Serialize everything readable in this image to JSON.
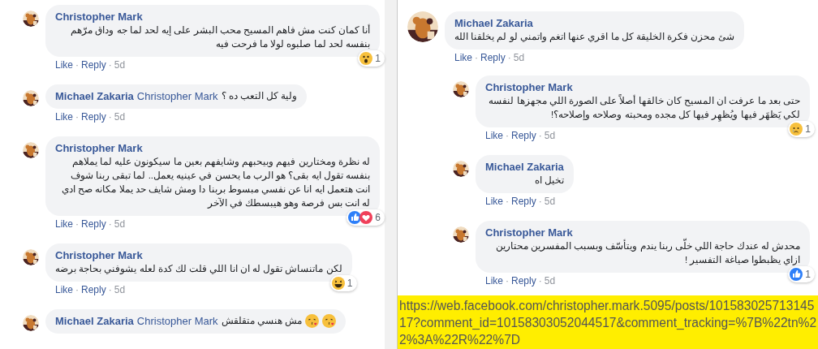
{
  "separator": "·",
  "left_comments": [
    {
      "author": "Christopher Mark",
      "text": "أنا كمان كنت مش فاهم المسيح محب البشر على إيه لحد لما جه وداق مرّهم بنفسه لحد لما صلبوه لولا ما فرحت فيه",
      "reactions": {
        "icons": [
          {
            "kind": "wow"
          }
        ],
        "count": "1"
      },
      "actions": {
        "like": "Like",
        "reply": "Reply",
        "time": "5d"
      }
    },
    {
      "author": "Michael Zakaria",
      "mention": "Christopher Mark",
      "text": "ولية كل التعب ده ؟",
      "actions": {
        "like": "Like",
        "reply": "Reply",
        "time": "5d"
      }
    },
    {
      "author": "Christopher Mark",
      "text": "له نظرة ومختارين فيهم وبيحبهم وشايفهم بعين ما سيكونون عليه لما يملاهم بنفسه تقول ايه بقى؟ هو الرب ما يحسن في عينيه يعمل.. لما تبقى ربنا شوف انت هتعمل ايه انا عن نفسي مبسوط بربنا دا ومش شايف حد يملا مكانه صح ادي له انت بس فرصة وهو هيبسطك في الآخر",
      "reactions": {
        "icons": [
          {
            "kind": "like"
          },
          {
            "kind": "love"
          }
        ],
        "count": "6"
      },
      "actions": {
        "like": "Like",
        "reply": "Reply",
        "time": "5d"
      }
    },
    {
      "author": "Christopher Mark",
      "text": "لكن ماتنساش تقول له ان انا اللي قلت لك كدة لعله يشوفني بحاجة برضه",
      "reactions": {
        "icons": [
          {
            "kind": "haha"
          }
        ],
        "count": "1"
      },
      "actions": {
        "like": "Like",
        "reply": "Reply",
        "time": "5d"
      }
    },
    {
      "author": "Michael Zakaria",
      "mention": "Christopher Mark",
      "text": "مش هنسي متقلقش",
      "emojis": [
        {
          "kind": "kiss"
        },
        {
          "kind": "kiss"
        }
      ]
    }
  ],
  "right_comments": [
    {
      "author": "Michael Zakaria",
      "text": "شئ محزن فكرة الخليقة كل ما اقري عنها اتغم واتمني لو لم يخلقنا الله",
      "actions": {
        "like": "Like",
        "reply": "Reply",
        "time": "5d"
      },
      "children": [
        {
          "author": "Christopher Mark",
          "text": "حتى بعد ما عرفت ان المسيح كان خالقها أصلاً على الصورة اللي مجهزها لنفسه لكي يَظهَر فيها ويُظهِر فيها كل مجده ومحبته وصلاحه وإصلاحه؟!",
          "reactions": {
            "icons": [
              {
                "kind": "sad"
              }
            ],
            "count": "1"
          },
          "actions": {
            "like": "Like",
            "reply": "Reply",
            "time": "5d"
          }
        },
        {
          "author": "Michael Zakaria",
          "text": "تخيل اه",
          "actions": {
            "like": "Like",
            "reply": "Reply",
            "time": "5d"
          }
        },
        {
          "author": "Christopher Mark",
          "text": "محدش له عندك حاجة اللي خلّى ربنا يندم ويتأسّف وبسبب المفسرين محتارين ازاي يظبطوا صياغة التفسير !",
          "reactions": {
            "icons": [
              {
                "kind": "like"
              }
            ],
            "count": "1"
          },
          "actions": {
            "like": "Like",
            "reply": "Reply",
            "time": "5d"
          }
        }
      ]
    }
  ],
  "link_note": "https://web.facebook.com/christopher.mark.5095/posts/10158302571314517?comment_id=10158303052044517&comment_tracking=%7B%22tn%22%3A%22R%22%7D"
}
